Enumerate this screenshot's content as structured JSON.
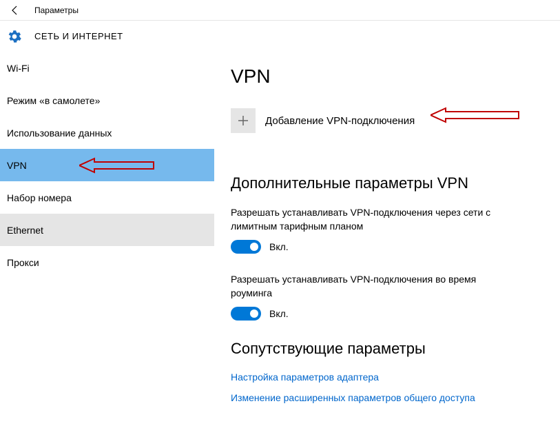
{
  "titlebar": {
    "title": "Параметры"
  },
  "header": {
    "title": "СЕТЬ И ИНТЕРНЕТ"
  },
  "sidebar": {
    "items": [
      {
        "label": "Wi-Fi"
      },
      {
        "label": "Режим «в самолете»"
      },
      {
        "label": "Использование данных"
      },
      {
        "label": "VPN"
      },
      {
        "label": "Набор номера"
      },
      {
        "label": "Ethernet"
      },
      {
        "label": "Прокси"
      }
    ]
  },
  "main": {
    "title": "VPN",
    "add_label": "Добавление VPN-подключения",
    "advanced_title": "Дополнительные параметры VPN",
    "setting1_desc": "Разрешать устанавливать VPN-подключения через сети с лимитным тарифным планом",
    "setting2_desc": "Разрешать устанавливать VPN-подключения во время роуминга",
    "toggle_on_label": "Вкл.",
    "related_title": "Сопутствующие параметры",
    "link1": "Настройка параметров адаптера",
    "link2": "Изменение расширенных параметров общего доступа"
  }
}
